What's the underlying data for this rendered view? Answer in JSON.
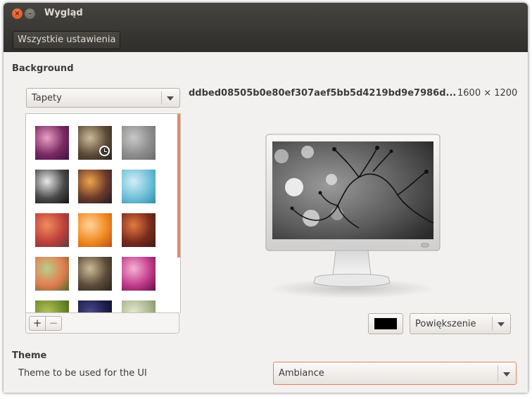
{
  "window": {
    "title": "Wygląd",
    "close_glyph": "×",
    "minimize_glyph": "–"
  },
  "toolbar": {
    "all_settings_label": "Wszystkie ustawienia"
  },
  "background": {
    "section_title": "Background",
    "source_combo": "Tapety",
    "selected_filename": "ddbed08505b0e80ef307aef5bb5d4219bd9e7986d...",
    "resolution": "1600 × 1200",
    "add_label": "+",
    "remove_label": "−",
    "color_swatch": "#000000",
    "placement_combo": "Powiększenie",
    "thumbnails": [
      {
        "name": "purple-bokeh",
        "colors": [
          "#e9a0c4",
          "#7a2a63",
          "#3d1140"
        ]
      },
      {
        "name": "fountain-pen",
        "colors": [
          "#cdbb98",
          "#5b4b38",
          "#2a241c"
        ],
        "selected": true
      },
      {
        "name": "foggy-deer",
        "colors": [
          "#c9c9c9",
          "#8d8d8d",
          "#6b6b6b"
        ]
      },
      {
        "name": "steampunk-gears",
        "colors": [
          "#e9e9e9",
          "#4b4b4b",
          "#111111"
        ]
      },
      {
        "name": "sunset-road",
        "colors": [
          "#f0a34a",
          "#6b3b2a",
          "#1e1c2a"
        ]
      },
      {
        "name": "blue-water",
        "colors": [
          "#d3eef6",
          "#6fc0d8",
          "#2f8dab"
        ]
      },
      {
        "name": "autumn-path",
        "colors": [
          "#f08d5c",
          "#c0403c",
          "#5a3b3a"
        ]
      },
      {
        "name": "orange-leaves",
        "colors": [
          "#ffd59a",
          "#f08a22",
          "#b95112"
        ]
      },
      {
        "name": "red-valley",
        "colors": [
          "#e57a40",
          "#7a2b1e",
          "#3d1d17"
        ]
      },
      {
        "name": "poppy-flowers",
        "colors": [
          "#b6cf8b",
          "#e47c4f",
          "#4d6b2f"
        ]
      },
      {
        "name": "fountain-pen-2",
        "colors": [
          "#cdbb98",
          "#5b4b38",
          "#2a241c"
        ]
      },
      {
        "name": "magenta-abstract",
        "colors": [
          "#f5b2d4",
          "#c23c8c",
          "#5e1142"
        ]
      },
      {
        "name": "green-leaves",
        "colors": [
          "#b5c25a",
          "#6d8a2c",
          "#3c4a1a"
        ]
      },
      {
        "name": "night-sky",
        "colors": [
          "#4b4a8c",
          "#1c1d4a",
          "#0a0a22"
        ]
      },
      {
        "name": "grass-meadow",
        "colors": [
          "#e6e6cf",
          "#a7b58c",
          "#6b7b4a"
        ]
      }
    ]
  },
  "theme": {
    "section_title": "Theme",
    "label": "Theme to be used for the UI",
    "value": "Ambiance"
  },
  "colors": {
    "accent": "#e3825f",
    "titlebar": "#3c3b37",
    "window_bg": "#f2f1f0"
  }
}
